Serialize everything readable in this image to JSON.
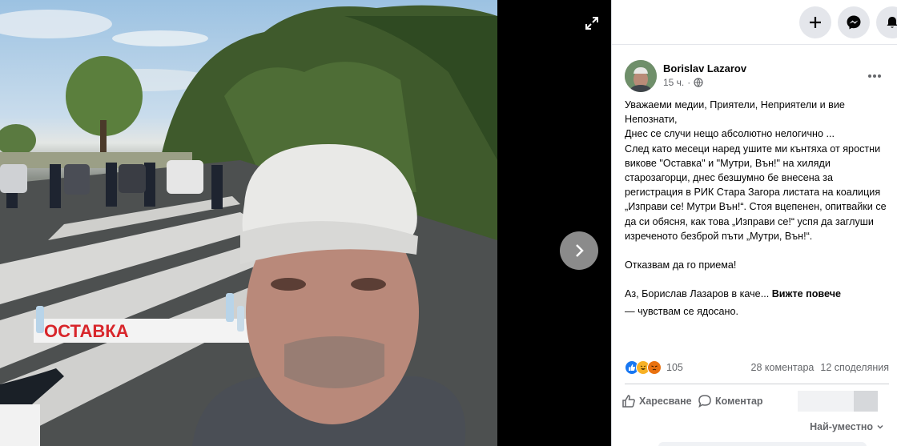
{
  "viewer": {
    "banner_text": "ОСТАВКА",
    "expand_icon": "expand-arrows-icon",
    "next_icon": "chevron-right-icon"
  },
  "topbar": {
    "buttons": [
      "plus-icon",
      "messenger-icon",
      "bell-icon"
    ]
  },
  "post": {
    "author": "Borislav Lazarov",
    "time": "15 ч.",
    "privacy_icon": "globe-icon",
    "paragraphs": [
      "Уважаеми медии, Приятели, Неприятели и вие Непознати,",
      "Днес се случи нещо абсолютно нелогично ...",
      "След като месеци наред ушите ми кънтяха от яростни викове \"Оставка\" и \"Мутри, Вън!\" на хиляди старозагорци, днес безшумно бе внесена за регистрация в РИК Стара Загора листата на коалиция „Изправи се! Мутри Вън!“. Стоя вцепенен, опитвайки се да си обясня, как това „Изправи се!“ успя да заглуши изреченото безброй пъти „Мутри, Вън!“."
    ],
    "paragraph2": "Отказвам да го приема!",
    "paragraph3": "Аз, Борислав Лазаров в каче...",
    "see_more": "Вижте повече",
    "feeling": "— чувствам се ядосано."
  },
  "stats": {
    "reaction_count": "105",
    "comments": "28 коментара",
    "shares": "12 споделяния"
  },
  "actions": {
    "like": "Харесване",
    "comment": "Коментар"
  },
  "sort_label": "Най-уместно",
  "colors": {
    "facebook_blue": "#1877f2",
    "text_secondary": "#65676b",
    "button_gray": "#e4e6eb"
  }
}
